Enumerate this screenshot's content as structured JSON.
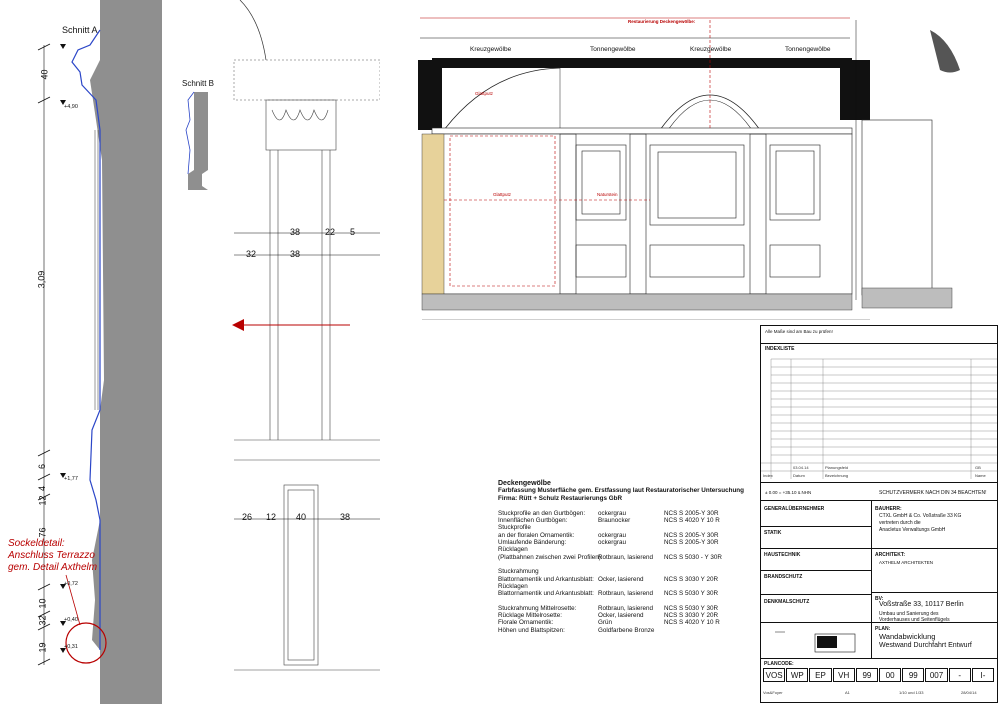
{
  "section_a": {
    "title": "Schnitt A",
    "dims": [
      "40",
      "3,09",
      "6",
      "4",
      "12",
      "76",
      "10",
      "32",
      "19"
    ],
    "levels": [
      "+4,90",
      "+1,77",
      "+0,72",
      "+0,40",
      "+0,31"
    ],
    "note": [
      "Sockeldetail:",
      "Anschluss Terrazzo",
      "gem. Detail Axthelm"
    ]
  },
  "section_b": {
    "title": "Schnitt B"
  },
  "column_dims": {
    "top": [
      "38",
      "22",
      "5"
    ],
    "mid": [
      "32",
      "38"
    ],
    "base": [
      "26",
      "12",
      "40",
      "38"
    ]
  },
  "elevation": {
    "vaults": [
      "Kreuzgewölbe",
      "Tonnengewölbe",
      "Kreuzgewölbe",
      "Tonnengewölbe"
    ],
    "labels": [
      "Glattputz",
      "Glattputz",
      "Naturstein"
    ],
    "restoration_title": "Restaurierung Deckengewölbe:"
  },
  "color_spec": {
    "title": "Deckengewölbe",
    "subtitle1": "Farbfassung Musterfläche gem. Erstfassung laut Restauratorischer Untersuchung",
    "subtitle2": "Firma: Rütt + Schulz Restaurierungs GbR",
    "rows": [
      {
        "a": "Stuckprofile an den Gurtbögen:",
        "b": "ockergrau",
        "c": "NCS S 2005-Y 30R"
      },
      {
        "a": "Innenflächen Gurtbögen:",
        "b": "Braunocker",
        "c": "NCS S 4020 Y 10 R"
      },
      {
        "a": "Stuckprofile",
        "b": "",
        "c": ""
      },
      {
        "a": "an der floralen Ornamentik:",
        "b": "ockergrau",
        "c": "NCS S 2005-Y 30R"
      },
      {
        "a": "Umlaufende Bänderung:",
        "b": "ockergrau",
        "c": "NCS S 2005-Y 30R"
      },
      {
        "a": "Rücklagen",
        "b": "",
        "c": ""
      },
      {
        "a": "(Plattbahnen zwischen zwei Profilen):",
        "b": "Rotbraun, lasierend",
        "c": "NCS S 5030 - Y 30R"
      },
      {
        "a": "",
        "b": "",
        "c": ""
      },
      {
        "a": "Stuckrahmung",
        "b": "",
        "c": ""
      },
      {
        "a": "Blattornamentik und Arkantusblatt:",
        "b": "Ocker, lasierend",
        "c": "NCS S 3030 Y 20R"
      },
      {
        "a": "Rücklagen",
        "b": "",
        "c": ""
      },
      {
        "a": "Blattornamentik und Arkantusblatt:",
        "b": "Rotbraun, lasierend",
        "c": "NCS S 5030 Y 30R"
      },
      {
        "a": "",
        "b": "",
        "c": ""
      },
      {
        "a": "Stuckrahmung Mittelrosette:",
        "b": "Rotbraun, lasierend",
        "c": "NCS S 5030 Y 30R"
      },
      {
        "a": "Rücklage Mittelrosette:",
        "b": "Ocker, lasierend",
        "c": "NCS S 3030 Y 20R"
      },
      {
        "a": "Florale Ornamentik:",
        "b": "Grün",
        "c": "NCS S 4020 Y 10 R"
      },
      {
        "a": "Höhen und Blattspitzen:",
        "b": "Goldfarbene Bronze",
        "c": ""
      }
    ]
  },
  "title_block": {
    "top_note": "Alle Maße sind am Bau zu prüfen!",
    "index_label": "INDEXLISTE",
    "index_row": {
      "date": "03.04.14",
      "desc": "Planungsfeld",
      "by": "GB"
    },
    "index_headers": [
      "Index",
      "Datum",
      "Bezeichnung",
      "Name"
    ],
    "level_note": "± 0.00 = +35.10 ü.NHN",
    "protection_note": "SCHUTZVERMERK NACH DIN 34 BEACHTEN!",
    "roles": [
      "GENERALÜBERNEHMER",
      "STATIK",
      "HAUSTECHNIK",
      "BRANDSCHUTZ",
      "DENKMALSCHUTZ"
    ],
    "client_label": "BAUHERR:",
    "client": [
      "CTXL GmbH & Co. Voßstraße 33 KG",
      "vertreten durch die",
      "Anacletus Verwaltungs GmbH"
    ],
    "architect_label": "ARCHITEKT:",
    "architect": "AXTHELM ARCHITEKTEN",
    "bv_label": "BV:",
    "bv": [
      "Voßstraße 33, 10117 Berlin",
      "Umbau und Sanierung des",
      "Vorderhauses und Seitenflügels"
    ],
    "plan_label": "PLAN:",
    "plan": [
      "Wandabwicklung",
      "Westwand Durchfahrt Entwurf"
    ],
    "plancode_label": "PLANCODE:",
    "codes": [
      "VOS",
      "WP",
      "EP",
      "VH",
      "99",
      "00",
      "99",
      "007",
      "-",
      "I-"
    ],
    "code_footer": [
      "Vos&Foyer",
      "A1",
      "1/10 und 1/33",
      "28/04/14"
    ]
  },
  "colors": {
    "red": "#b80000",
    "wall_gray": "#8f8f8f",
    "ochre": "#e7d29a"
  }
}
